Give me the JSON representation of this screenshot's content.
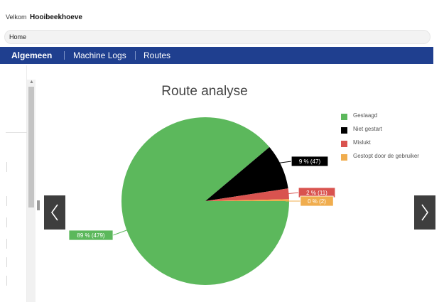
{
  "header": {
    "welcome_label": "Velkom",
    "user_name": "Hooibeekhoeve"
  },
  "breadcrumb": {
    "home": "Home"
  },
  "nav": {
    "items": [
      "Algemeen",
      "Machine Logs",
      "Routes"
    ]
  },
  "carousel": {
    "prev_icon": "chevron-left-icon",
    "next_icon": "chevron-right-icon"
  },
  "chart_data": {
    "type": "pie",
    "title": "Route analyse",
    "legend_position": "right",
    "series": [
      {
        "name": "Geslaagd",
        "value": 479,
        "label": "89 % (479)",
        "color": "#5cb85c"
      },
      {
        "name": "Niet gestart",
        "value": 47,
        "label": "9 % (47)",
        "color": "#000000"
      },
      {
        "name": "Mislukt",
        "value": 11,
        "label": "2 % (11)",
        "color": "#d9534f"
      },
      {
        "name": "Gestopt door de gebruiker",
        "value": 2,
        "label": "0 % (2)",
        "color": "#f0ad4e"
      }
    ]
  }
}
